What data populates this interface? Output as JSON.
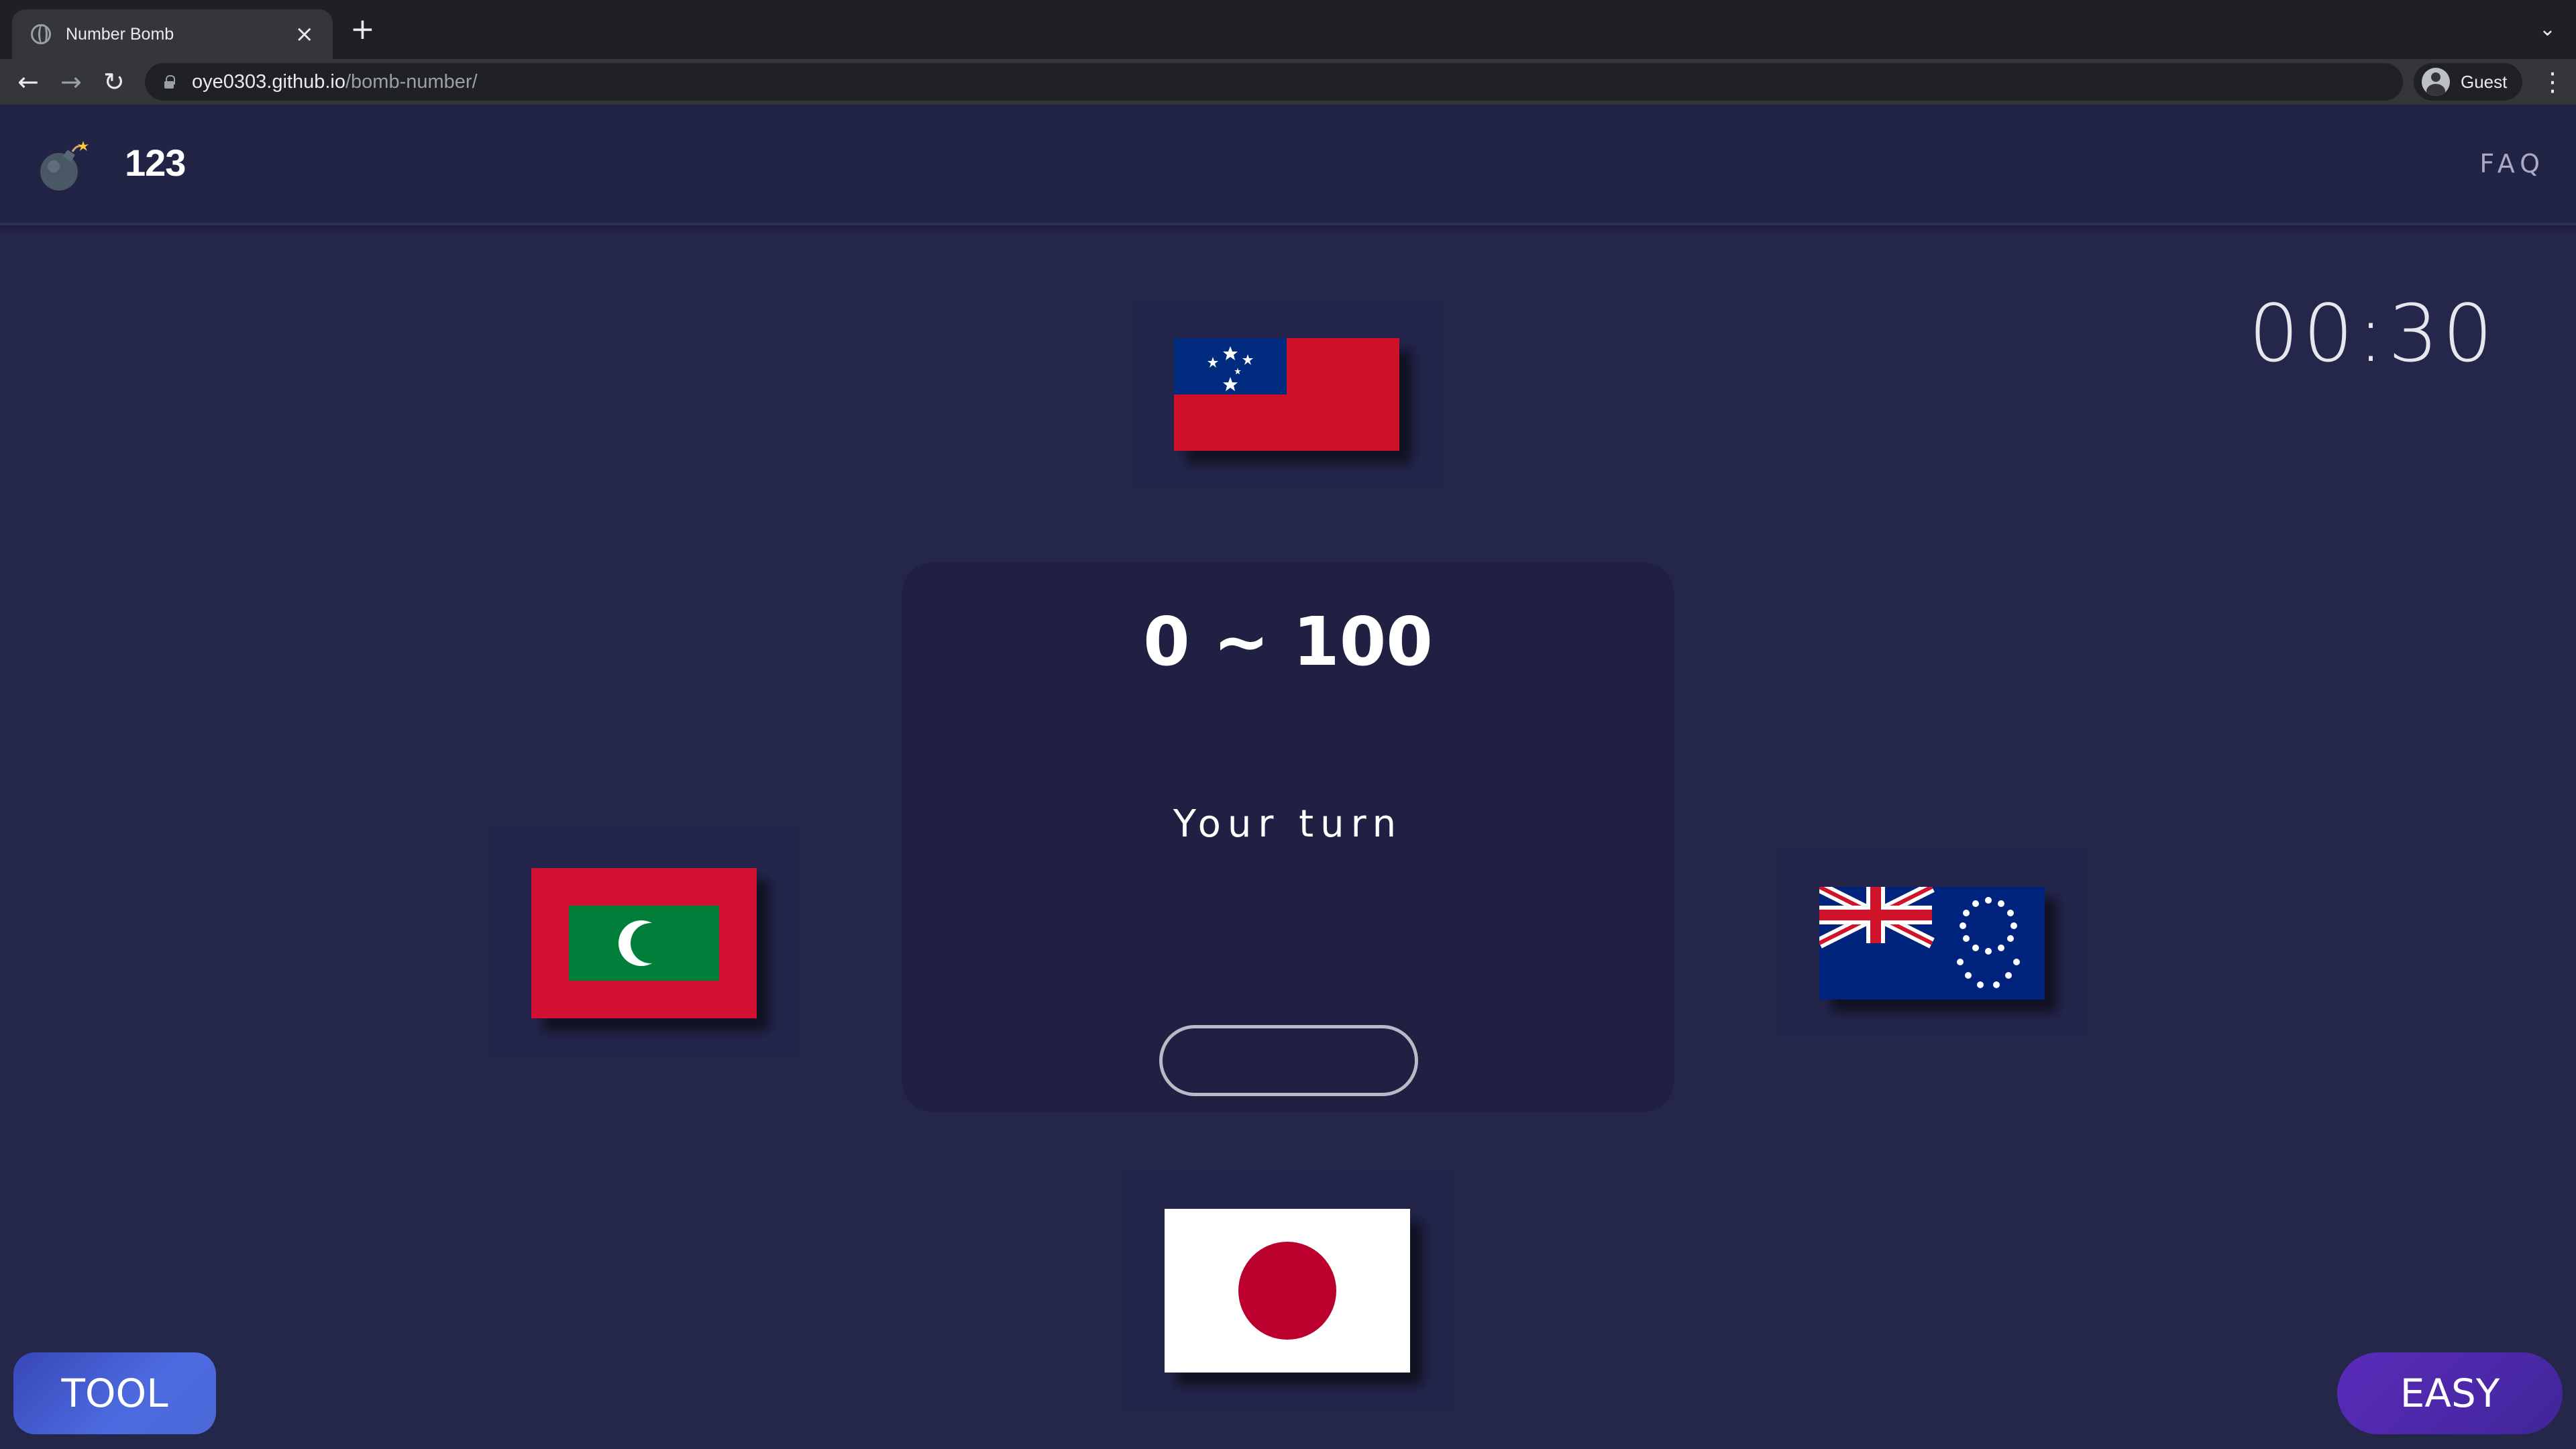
{
  "browser": {
    "tab_title": "Number Bomb",
    "tab_close": "×",
    "new_tab": "+",
    "tab_list": "⌄",
    "url_host": "oye0303.github.io",
    "url_path": "/bomb-number/",
    "profile_label": "Guest",
    "back": "←",
    "forward": "→",
    "reload": "↻",
    "menu": "⋮"
  },
  "header": {
    "logo_icon": "bomb-icon",
    "logo_text": "123",
    "faq_label": "FAQ"
  },
  "game": {
    "timer": "00:30",
    "range_text": "0 ~ 100",
    "turn_text": "Your turn",
    "guess_value": "",
    "players": [
      {
        "position": "top",
        "flag": "samoa-flag"
      },
      {
        "position": "left",
        "flag": "maldives-flag"
      },
      {
        "position": "right",
        "flag": "cook-islands-flag"
      },
      {
        "position": "bottom",
        "flag": "japan-flag"
      }
    ]
  },
  "buttons": {
    "tool_label": "TOOL",
    "difficulty_label": "EASY"
  },
  "colors": {
    "page_bg": "#24264a",
    "board_bg": "#202142",
    "tool_button": "#4d6be0",
    "easy_button": "#4b28a8"
  }
}
